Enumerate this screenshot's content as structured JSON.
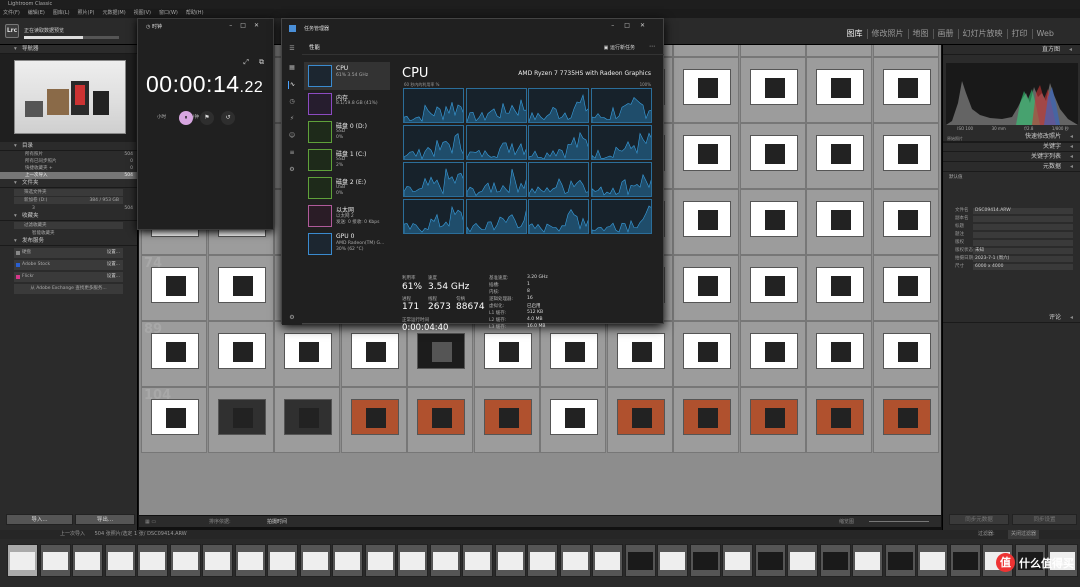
{
  "app_title": "Lightroom Classic",
  "menu": [
    "文件(F)",
    "编辑(E)",
    "图库(L)",
    "照片(P)",
    "元数据(M)",
    "视图(V)",
    "窗口(W)",
    "帮助(H)"
  ],
  "header": {
    "logo": "Lrc",
    "import_status": "正在读取数据预览",
    "import_progress": 0.62,
    "modules": [
      "图库",
      "修改照片",
      "地图",
      "画册",
      "幻灯片放映",
      "打印",
      "Web"
    ],
    "active_module": "图库"
  },
  "left_panel": {
    "navigator": {
      "title": "导航器",
      "zoom_options": "适合 · 填满 · 100% · 100%"
    },
    "catalog": {
      "title": "目录",
      "items": [
        {
          "label": "所有照片",
          "count": "504"
        },
        {
          "label": "所有已同步照片",
          "count": "0"
        },
        {
          "label": "快捷收藏夹 +",
          "count": "0"
        },
        {
          "label": "上一次导入",
          "count": "504"
        }
      ]
    },
    "folders": {
      "title": "文件夹",
      "filter": "筛选文件夹",
      "volume": "新加卷 (D:)",
      "volume_space": "384 / 953 GB",
      "folder": "3",
      "folder_count": "504"
    },
    "collections": {
      "title": "收藏夹",
      "filter": "过滤收藏夹",
      "smart": "智能收藏夹"
    },
    "publish": {
      "title": "发布服务",
      "services": [
        {
          "label": "硬盘",
          "action": "设置..."
        },
        {
          "label": "Adobe Stock",
          "action": "设置..."
        },
        {
          "label": "Flickr",
          "action": "设置..."
        }
      ],
      "more": "从 Adobe Exchange 查找更多服务..."
    },
    "import_button": "导入...",
    "export_button": "导出..."
  },
  "grid": {
    "start_number": 22,
    "rows_numbers": [
      22,
      37,
      52,
      67
    ]
  },
  "right_panel": {
    "histogram_title": "直方图",
    "histogram_info": [
      "ISO 100",
      "30 mm",
      "f/2.8",
      "1/800 秒"
    ],
    "original_photo": "原始照片",
    "quick_develop": "快速修改照片",
    "keywording": "关键字",
    "keyword_list": "关键字列表",
    "metadata_title": "元数据",
    "metadata_preset_label": "预设",
    "metadata_preset_value": "默认值",
    "metadata_rows": [
      {
        "label": "文件名",
        "value": "DSC09414.ARW"
      },
      {
        "label": "副本名",
        "value": ""
      },
      {
        "label": "标题",
        "value": ""
      },
      {
        "label": "题注",
        "value": ""
      },
      {
        "label": "版权",
        "value": ""
      },
      {
        "label": "版权状态",
        "value": "未知"
      },
      {
        "label": "拍摄日期",
        "value": "2023-7-1 (周六)"
      },
      {
        "label": "尺寸",
        "value": "6000 x 4000"
      }
    ],
    "comments": "评论",
    "sync_meta": "同步元数据",
    "sync_settings": "同步设置"
  },
  "toolbar": {
    "sort_label": "排序依据:",
    "sort_value": "拍摄时间",
    "thumbs_label": "缩览图"
  },
  "filmstrip_header": {
    "nav": "上一次导入",
    "info": "504 张照片/选定 1 张/",
    "filename": "DSC09414.ARW",
    "filter_label": "过滤器:",
    "filter_value": "关闭过滤器"
  },
  "watermark": {
    "logo": "值",
    "text": "什么值得买"
  },
  "clock": {
    "title": "时钟",
    "time": "00:00:14",
    "ms": ".22",
    "units": [
      "小时",
      "分钟",
      "秒"
    ]
  },
  "task_manager": {
    "title": "任务管理器",
    "page": "性能",
    "run_task": "运行新任务",
    "list": [
      {
        "name": "CPU",
        "line2": "61%  3.54 GHz",
        "line3": ""
      },
      {
        "name": "内存",
        "line2": "8.1/19.8 GB (41%)",
        "line3": ""
      },
      {
        "name": "磁盘 0 (D:)",
        "line2": "SSD",
        "line3": "0%"
      },
      {
        "name": "磁盘 1 (C:)",
        "line2": "SSD",
        "line3": "2%"
      },
      {
        "name": "磁盘 2 (E:)",
        "line2": "USB",
        "line3": "0%"
      },
      {
        "name": "以太网",
        "line2": "以太网 2",
        "line3": "发送: 0 接收: 0 Kbps"
      },
      {
        "name": "GPU 0",
        "line2": "AMD Radeon(TM) G...",
        "line3": "30% (62 °C)"
      }
    ],
    "cpu_title": "CPU",
    "cpu_model": "AMD Ryzen 7 7735HS with Radeon Graphics",
    "util_label": "60 秒内的利用率 %",
    "util_max": "100%",
    "stats": {
      "util_label": "利用率",
      "util": "61%",
      "speed_label": "速度",
      "speed": "3.54 GHz",
      "proc_label": "进程",
      "proc": "171",
      "thread_label": "线程",
      "thread": "2673",
      "handle_label": "句柄",
      "handle": "88674",
      "uptime_label": "正常运行时间",
      "uptime": "0:00:04:40"
    },
    "specs": [
      {
        "k": "基准速度:",
        "v": "3.20 GHz"
      },
      {
        "k": "插槽:",
        "v": "1"
      },
      {
        "k": "内核:",
        "v": "8"
      },
      {
        "k": "逻辑处理器:",
        "v": "16"
      },
      {
        "k": "虚拟化:",
        "v": "已启用"
      },
      {
        "k": "L1 缓存:",
        "v": "512 KB"
      },
      {
        "k": "L2 缓存:",
        "v": "4.0 MB"
      },
      {
        "k": "L3 缓存:",
        "v": "16.0 MB"
      }
    ]
  }
}
